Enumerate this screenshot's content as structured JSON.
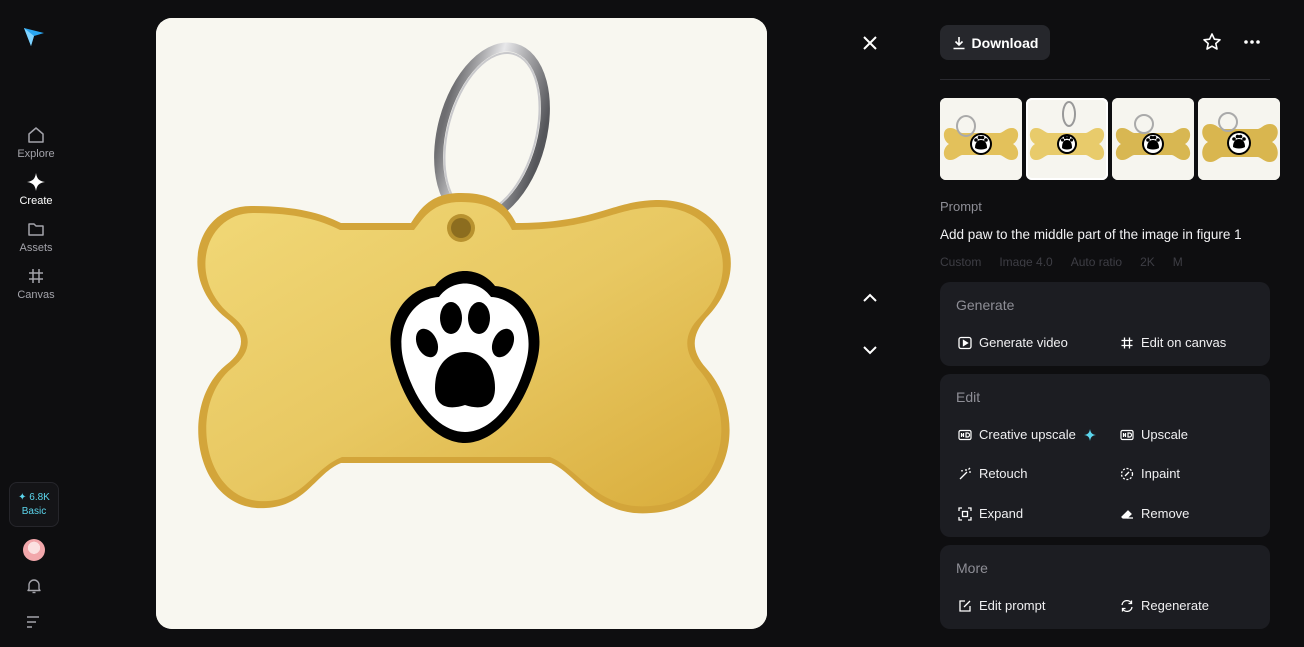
{
  "nav": {
    "items": [
      {
        "label": "Explore",
        "icon": "home-icon"
      },
      {
        "label": "Create",
        "icon": "sparkle-icon"
      },
      {
        "label": "Assets",
        "icon": "folder-icon"
      },
      {
        "label": "Canvas",
        "icon": "hash-icon"
      }
    ],
    "credits": {
      "amount": "✦ 6.8K",
      "plan": "Basic"
    }
  },
  "toolbar": {
    "download_label": "Download"
  },
  "prompt": {
    "label": "Prompt",
    "text": "Add paw to the middle part of the image in figure 1",
    "meta": [
      "Custom",
      "Image 4.0",
      "Auto ratio",
      "2K",
      "M"
    ]
  },
  "generate": {
    "title": "Generate",
    "actions": [
      "Generate video",
      "Edit on canvas"
    ]
  },
  "edit": {
    "title": "Edit",
    "actions": [
      "Creative upscale",
      "Upscale",
      "Retouch",
      "Inpaint",
      "Expand",
      "Remove"
    ]
  },
  "more": {
    "title": "More",
    "actions": [
      "Edit prompt",
      "Regenerate"
    ]
  },
  "colors": {
    "accent": "#5bd5ec",
    "background": "#0e0e10",
    "card": "#1c1d22",
    "tag_gold": "#e7c65a"
  }
}
